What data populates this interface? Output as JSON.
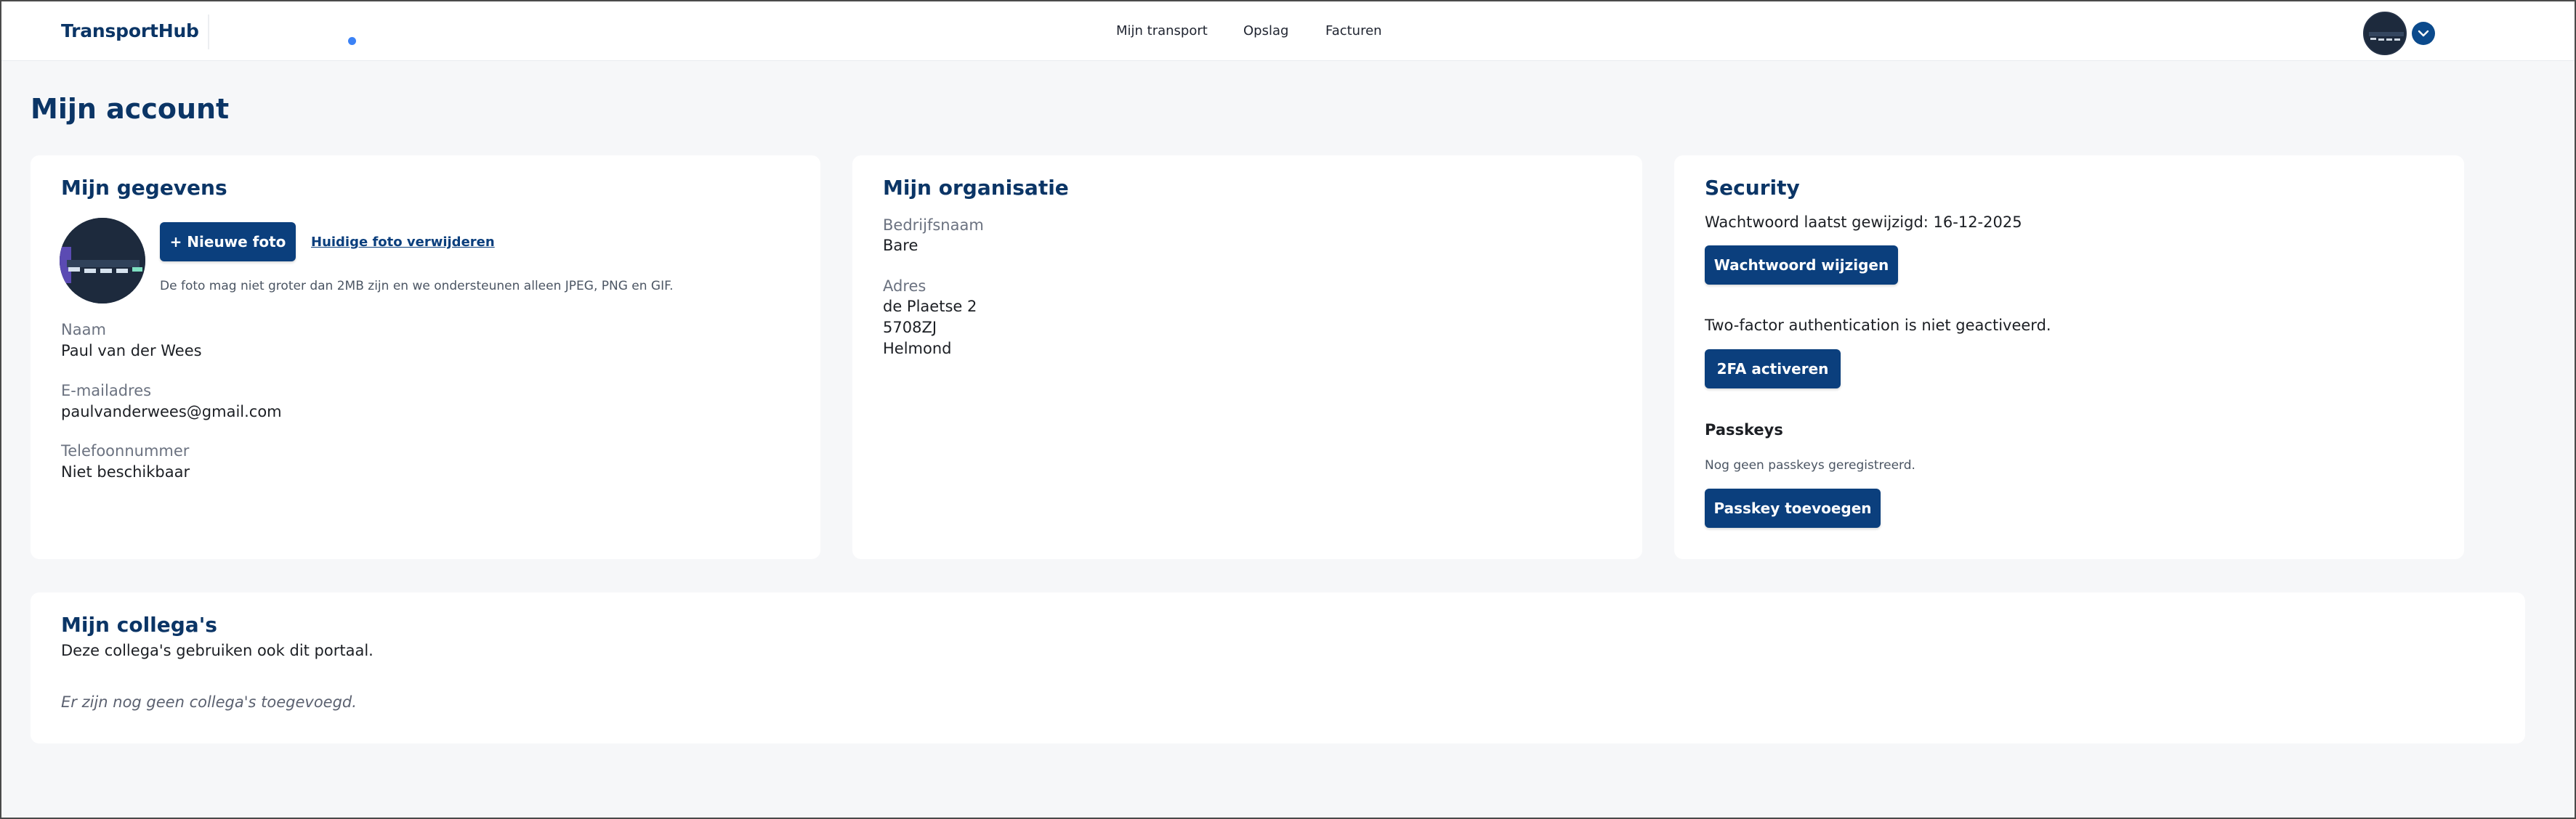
{
  "header": {
    "brand": "TransportHub",
    "nav": [
      "Mijn transport",
      "Opslag",
      "Facturen"
    ]
  },
  "page": {
    "title": "Mijn account"
  },
  "profile": {
    "title": "Mijn gegevens",
    "new_photo": "+ Nieuwe foto",
    "remove_photo": "Huidige foto verwijderen",
    "photo_hint": "De foto mag niet groter dan 2MB zijn en we ondersteunen alleen JPEG, PNG en GIF.",
    "name_label": "Naam",
    "name_value": "Paul van der Wees",
    "email_label": "E-mailadres",
    "email_value": "paulvanderwees@gmail.com",
    "phone_label": "Telefoonnummer",
    "phone_value": "Niet beschikbaar"
  },
  "organization": {
    "title": "Mijn organisatie",
    "company_label": "Bedrijfsnaam",
    "company_value": "Bare",
    "address_label": "Adres",
    "address_lines": [
      "de Plaetse 2",
      "5708ZJ",
      "Helmond"
    ]
  },
  "security": {
    "title": "Security",
    "password_changed": "Wachtwoord laatst gewijzigd: 16-12-2025",
    "change_password": "Wachtwoord wijzigen",
    "twofa_status": "Two-factor authentication is niet geactiveerd.",
    "activate_2fa": "2FA activeren",
    "passkeys_title": "Passkeys",
    "passkeys_status": "Nog geen passkeys geregistreerd.",
    "add_passkey": "Passkey toevoegen"
  },
  "colleagues": {
    "title": "Mijn collega's",
    "subtitle": "Deze collega's gebruiken ook dit portaal.",
    "empty": "Er zijn nog geen collega's toegevoegd."
  },
  "colors": {
    "brand": "#0b3566",
    "button": "#0b3f7d",
    "accent_dot": "#3b82f6"
  }
}
